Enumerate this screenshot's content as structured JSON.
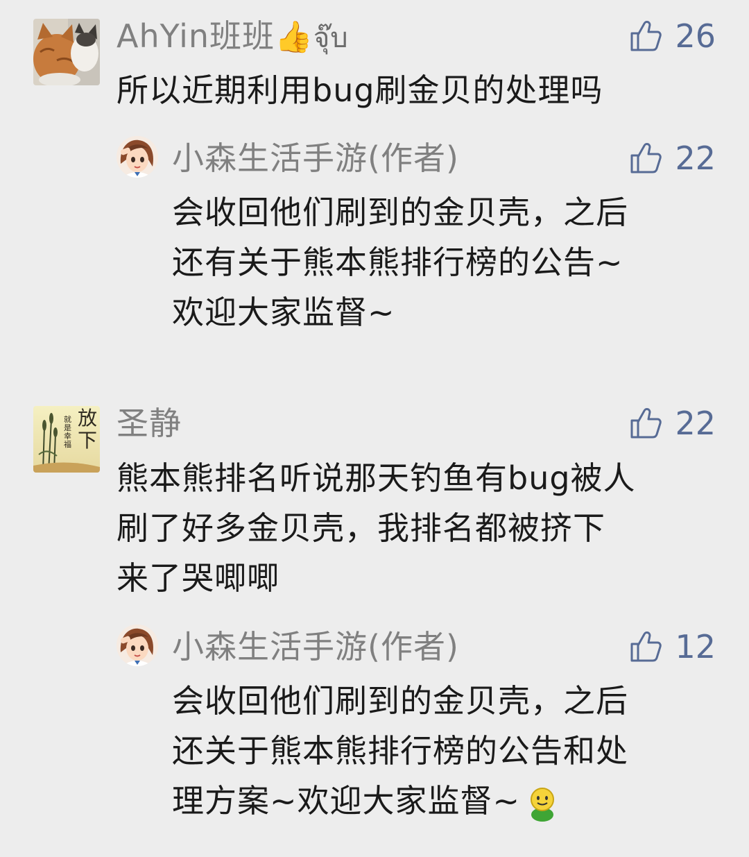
{
  "colors": {
    "background": "#ededed",
    "name": "#808080",
    "text": "#1a1a1a",
    "like": "#576b95"
  },
  "comments": [
    {
      "name": "AhYin班班",
      "name_emoji": "👍",
      "name_suffix": "จุ๊บ",
      "text": "所以近期利用bug刷金贝的处理吗",
      "likes": "26",
      "avatar": "cat-avatar",
      "reply": {
        "name": "小森生活手游(作者)",
        "text": "会收回他们刷到的金贝壳，之后\n还有关于熊本熊排行榜的公告~\n欢迎大家监督~",
        "likes": "22",
        "avatar": "cartoon-girl-avatar"
      }
    },
    {
      "name": "圣静",
      "text": "熊本熊排名听说那天钓鱼有bug被人\n刷了好多金贝壳，我排名都被挤下\n来了哭唧唧",
      "likes": "22",
      "avatar": "calligraphy-avatar",
      "avatar_text": {
        "big": "放下",
        "small": "就是幸福"
      },
      "reply": {
        "name": "小森生活手游(作者)",
        "text": "会收回他们刷到的金贝壳，之后\n还关于熊本熊排行榜的公告和处\n理方案~欢迎大家监督~",
        "likes": "12",
        "avatar": "cartoon-girl-avatar",
        "trailing_emoji": "smile-emoji"
      }
    }
  ]
}
